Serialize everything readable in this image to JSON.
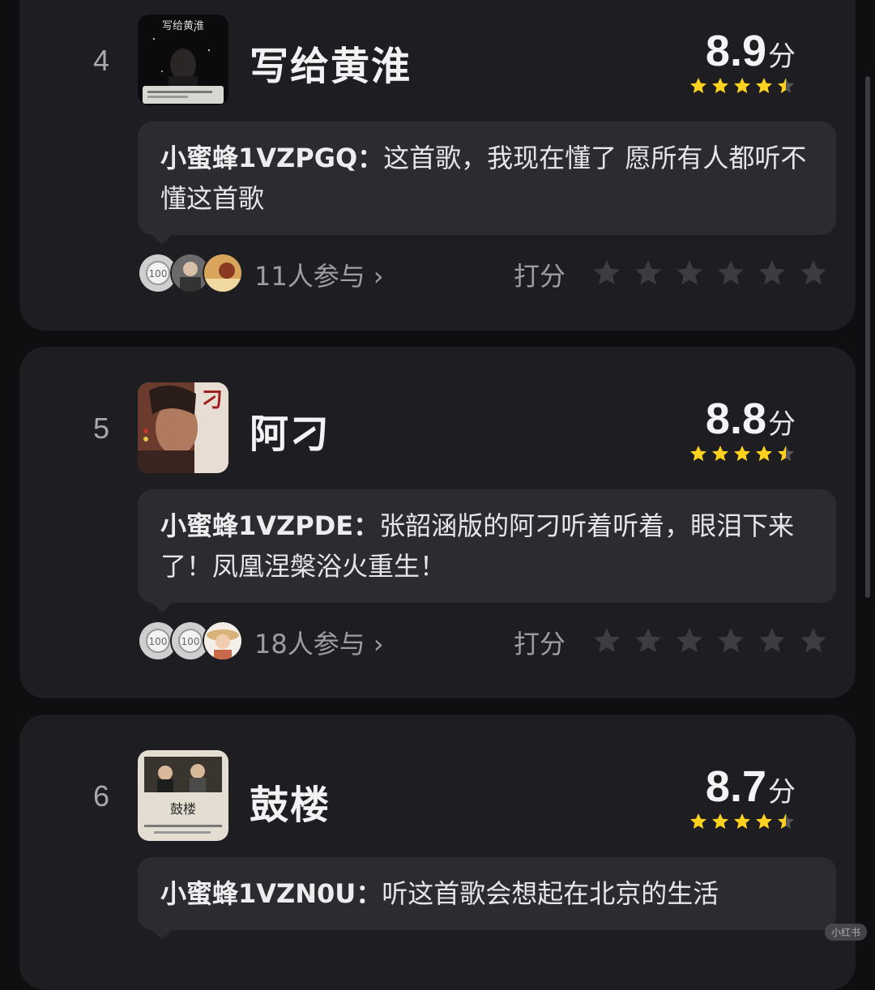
{
  "list": {
    "items": [
      {
        "rank": "4",
        "title": "写给黄淮",
        "score": "8.9",
        "unit": "分",
        "stars_rating": 4.5,
        "comment_author": "小蜜蜂1VZPGQ：",
        "comment_text": "这首歌，我现在懂了 愿所有人都听不懂这首歌",
        "participants": "11人参与",
        "rate_label": "打分",
        "cover_text": "写给黄淮"
      },
      {
        "rank": "5",
        "title": "阿刁",
        "score": "8.8",
        "unit": "分",
        "stars_rating": 4.5,
        "comment_author": "小蜜蜂1VZPDE：",
        "comment_text": "张韶涵版的阿刁听着听着，眼泪下来了！凤凰涅槃浴火重生！",
        "participants": "18人参与",
        "rate_label": "打分",
        "cover_text": "刁"
      },
      {
        "rank": "6",
        "title": "鼓楼",
        "score": "8.7",
        "unit": "分",
        "stars_rating": 4.5,
        "comment_author": "小蜜蜂1VZN0U：",
        "comment_text": "听这首歌会想起在北京的生活",
        "participants": "",
        "rate_label": "",
        "cover_text": "鼓楼"
      }
    ]
  },
  "colors": {
    "background": "#0f0f12",
    "card": "#1e1e22",
    "bubble": "#2b2b30",
    "star_gold": "#ffd21f",
    "star_empty": "#3c3c42"
  },
  "icons": {
    "star": "star-icon",
    "chevron": "chevron-right-icon"
  },
  "watermark": "小红书"
}
